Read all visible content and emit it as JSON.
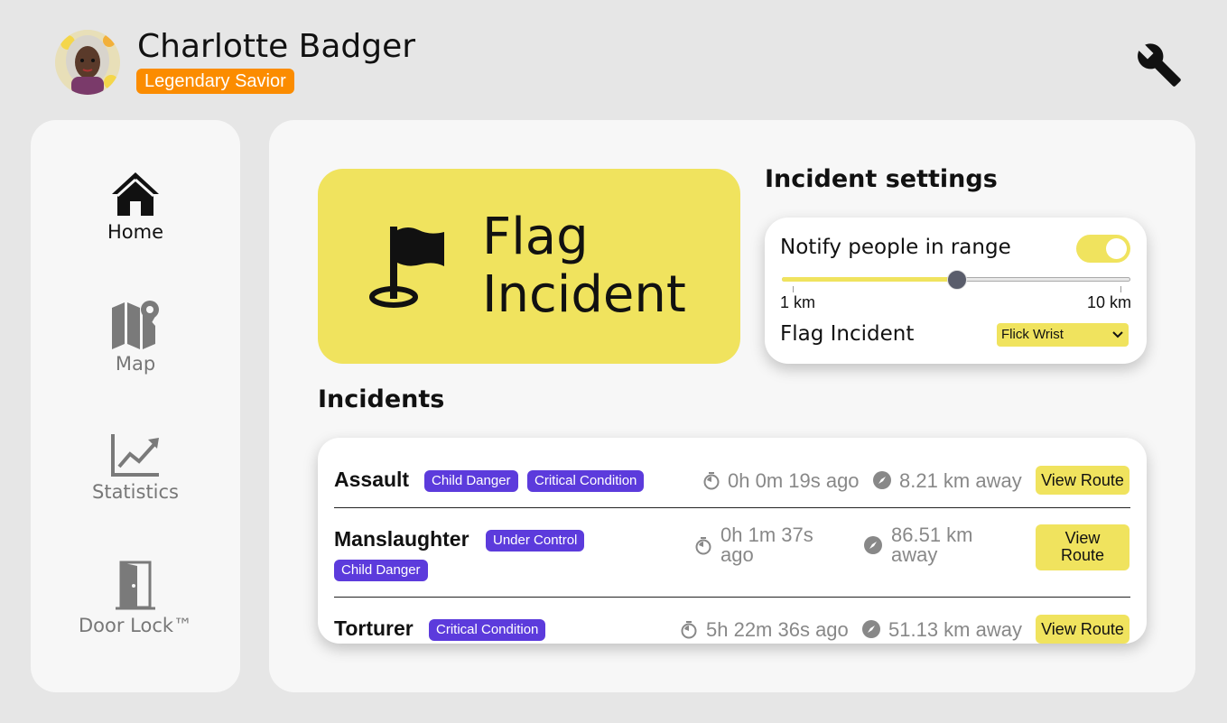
{
  "user": {
    "name": "Charlotte Badger",
    "rank": "Legendary Savior"
  },
  "nav": [
    {
      "label": "Home",
      "icon": "home-icon",
      "active": true
    },
    {
      "label": "Map",
      "icon": "map-icon",
      "active": false
    },
    {
      "label": "Statistics",
      "icon": "chart-line-icon",
      "active": false
    },
    {
      "label": "Door Lock™",
      "icon": "door-icon",
      "active": false
    }
  ],
  "flag_button": {
    "line1": "Flag",
    "line2": "Incident",
    "icon": "flag-icon"
  },
  "incident_settings": {
    "title": "Incident settings",
    "notify_label": "Notify people in range",
    "notify_enabled": true,
    "range_min": "1 km",
    "range_max": "10 km",
    "range_fraction": 0.5,
    "flag_label": "Flag Incident",
    "flag_gesture": "Flick Wrist"
  },
  "incidents_title": "Incidents",
  "incidents": [
    {
      "name": "Assault",
      "tags": [
        "Child Danger",
        "Critical Condition"
      ],
      "time": "0h 0m 19s ago",
      "distance": "8.21 km away",
      "action": "View Route"
    },
    {
      "name": "Manslaughter",
      "tags": [
        "Under Control",
        "Child Danger"
      ],
      "time_line1": "0h 1m 37s",
      "time_line2": "ago",
      "distance_line1": "86.51 km",
      "distance_line2": "away",
      "action_line1": "View",
      "action_line2": "Route"
    },
    {
      "name": "Torturer",
      "tags": [
        "Critical Condition"
      ],
      "time": "5h 22m 36s ago",
      "distance": "51.13 km away",
      "action": "View Route"
    }
  ],
  "colors": {
    "accent_yellow": "#f0e35e",
    "badge_orange": "#fb8c00",
    "tag_purple": "#5c3bdc",
    "background": "#e6e6e6",
    "panel": "#f7f7f7"
  }
}
